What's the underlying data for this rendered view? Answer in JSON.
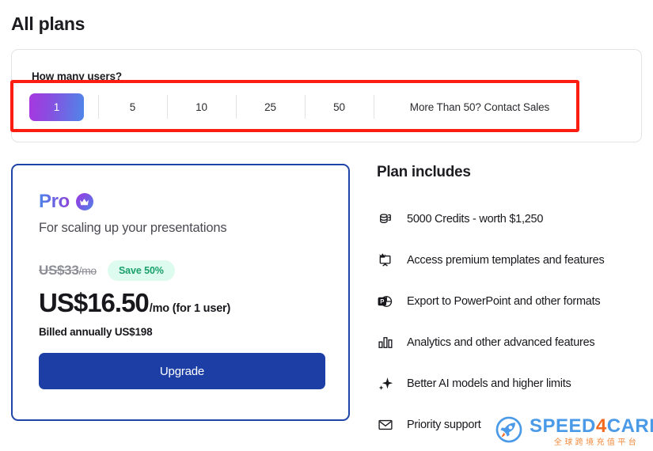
{
  "page": {
    "title": "All plans"
  },
  "user_selector": {
    "label": "How many users?",
    "options": [
      {
        "label": "1",
        "active": true
      },
      {
        "label": "5",
        "active": false
      },
      {
        "label": "10",
        "active": false
      },
      {
        "label": "25",
        "active": false
      },
      {
        "label": "50",
        "active": false
      }
    ],
    "contact_option": "More Than 50? Contact Sales",
    "active_gradient_from": "#a737e0",
    "active_gradient_to": "#4f86e8"
  },
  "annotation": {
    "color": "#fb1d0f",
    "target": "user-count-selector"
  },
  "plan_card": {
    "name": "Pro",
    "badge_icon": "crown-icon",
    "subtitle": "For scaling up your presentations",
    "old_price": "US$33",
    "old_price_period": "/mo",
    "save_badge": "Save 50%",
    "price": "US$16.50",
    "price_unit": "/mo (for 1 user)",
    "billed_note": "Billed annually US$198",
    "cta_label": "Upgrade",
    "border_color": "#1f45a8",
    "cta_color": "#1d3fa5",
    "save_badge_bg": "#ddfbee",
    "save_badge_color": "#1aa06a"
  },
  "plan_includes": {
    "title": "Plan includes",
    "features": [
      {
        "icon": "credits-coins-icon",
        "text": "5000 Credits - worth $1,250"
      },
      {
        "icon": "premium-template-icon",
        "text": "Access premium templates and features"
      },
      {
        "icon": "powerpoint-export-icon",
        "text": "Export to PowerPoint and other formats"
      },
      {
        "icon": "bar-chart-icon",
        "text": "Analytics and other advanced features"
      },
      {
        "icon": "sparkle-icon",
        "text": "Better AI models and higher limits"
      },
      {
        "icon": "envelope-icon",
        "text": "Priority support"
      }
    ]
  },
  "watermark": {
    "brand_part1": "SPEED",
    "brand_four": "4",
    "brand_part2": "CARD",
    "subtitle": "全球跨境充值平台",
    "icon": "rocket-icon",
    "brand_color": "#4b9ae8",
    "accent_color": "#f26a1f"
  }
}
